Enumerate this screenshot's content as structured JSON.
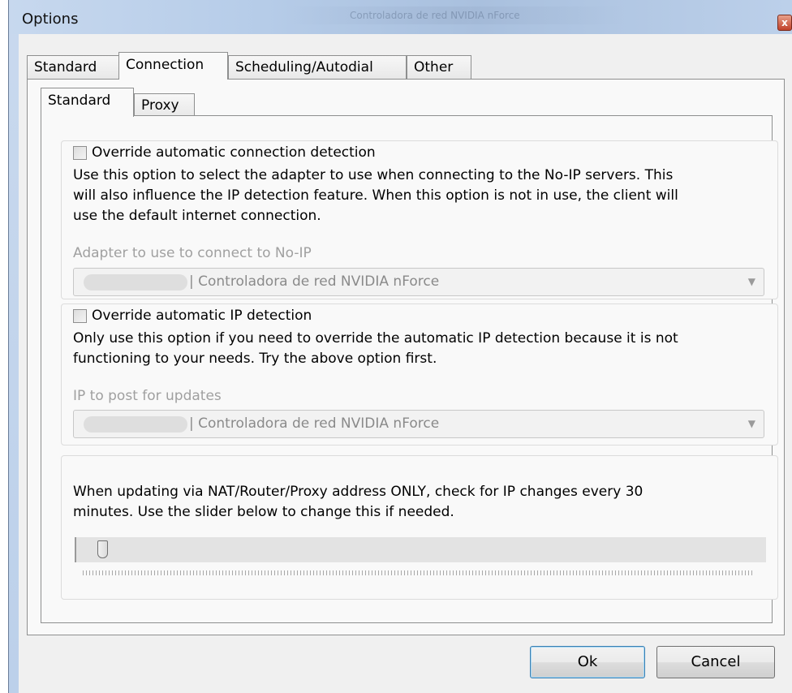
{
  "window": {
    "title": "Options",
    "background_title": "Controladora de red NVIDIA nForce",
    "close_label": "x"
  },
  "tabs": [
    {
      "label": "Standard",
      "active": false
    },
    {
      "label": "Connection",
      "active": true
    },
    {
      "label": "Scheduling/Autodial",
      "active": false
    },
    {
      "label": "Other",
      "active": false
    }
  ],
  "subtabs": [
    {
      "label": "Standard",
      "active": true
    },
    {
      "label": "Proxy",
      "active": false
    }
  ],
  "group_adapter": {
    "checkbox_label": "Override automatic connection detection",
    "checked": false,
    "description_lines": [
      "Use this option to select the adapter to use when connecting to the No-IP servers.  This",
      "will also influence the IP detection feature.  When this option is not in use, the client will",
      "use the default internet connection."
    ],
    "field_label": "Adapter to use to connect to No-IP",
    "combo_value": "| Controladora de red NVIDIA nForce"
  },
  "group_ip": {
    "checkbox_label": "Override automatic IP detection",
    "checked": false,
    "description_lines": [
      "Only use this option if you need to override the automatic IP detection because it is not",
      "functioning to your needs.  Try the above option first."
    ],
    "field_label": "IP to post for updates",
    "combo_value": "| Controladora de red NVIDIA nForce"
  },
  "group_interval": {
    "description_lines": [
      "When updating via NAT/Router/Proxy address ONLY, check for IP changes every 30",
      "minutes.  Use the slider below to change this if needed."
    ],
    "slider_value_fraction": 0.03
  },
  "buttons": {
    "ok": "Ok",
    "cancel": "Cancel"
  },
  "icons": {
    "combo_arrow": "chevron-down-icon",
    "close": "close-icon"
  },
  "colors": {
    "titlebar": "#bcd0ea",
    "dialog_bg": "#f0f0f0",
    "disabled_text": "#a0a0a0"
  }
}
